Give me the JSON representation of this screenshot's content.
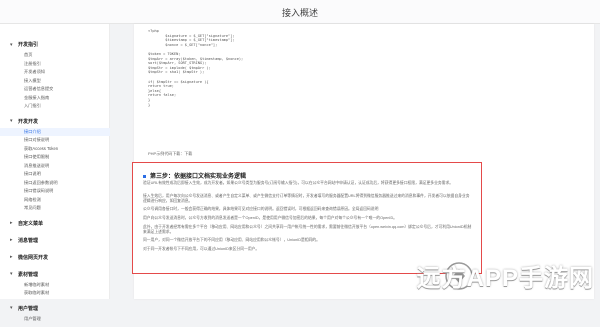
{
  "header": {
    "title": "接入概述"
  },
  "sidebar": {
    "sections": [
      {
        "label": "开发指引",
        "items": [
          "首页",
          "注册指引",
          "开发者须知",
          "接入模型",
          "运营者信息提交",
          "金服接入指南",
          "入门指引"
        ]
      },
      {
        "label": "开发开发",
        "items": [
          "接口介绍",
          "接口对接说明",
          "获取Access Token",
          "接口使用限制",
          "消息推送说明",
          "接口说明",
          "接口返回参数说明",
          "接口错误码说明",
          "网络检测",
          "常见问题"
        ],
        "active_index": 0
      },
      {
        "label": "自定义菜单",
        "items": []
      },
      {
        "label": "消息管理",
        "items": []
      },
      {
        "label": "微信网页开发",
        "items": []
      },
      {
        "label": "素材管理",
        "items": [
          "新增临时素材",
          "获取临时素材"
        ]
      },
      {
        "label": "用户管理",
        "items": [
          "用户管理"
        ]
      }
    ]
  },
  "code": {
    "lines": [
      "<?php",
      "        $signature = $_GET[\"signature\"];",
      "        $timestamp = $_GET[\"timestamp\"];",
      "        $nonce = $_GET[\"nonce\"];",
      "",
      "$token = TOKEN;",
      "$tmpArr = array($token, $timestamp, $nonce);",
      "sort($tmpArr, SORT_STRING);",
      "$tmpStr = implode( $tmpArr );",
      "$tmpStr = sha1( $tmpStr );",
      "",
      "if( $tmpStr == $signature ){",
      "return true;",
      "}else{",
      "return false;",
      "}",
      "}"
    ],
    "note": "PHP示例代码下载：下载"
  },
  "step": {
    "title": "第三步：依据接口文档实现业务逻辑",
    "paragraphs": [
      "验证URL有效性成功后即接入生效，成为开发者。如果公众号类型为服务号(订阅号输入指引)，可以在公众平台网站中申请认证，认证成功后，将获得更多接口权限，满足更多业务需求。",
      "接入生效后，用户每次向公众号发送消息、或者产生自定义菜单、或产生微信支付订单等情况时，开发者填写的服务器配置URL将得到微信服务器推送过来的消息和事件，开发者可以依据自身业务逻辑进行响应，如回复消息。",
      "公众号调用各接口时，一般会获得正确的结果，具体结果可见对应接口的说明。返回错误时，可根据返回码来查询错误原因。全局返回码说明",
      "用户向公众号发送消息时，公众号方收到的消息发送者是一个OpenID，是使用用户微信号加密后的结果，每个用户对每个公众号有一个唯一的OpenID。",
      "此外，由于开发者经常有需在多个平台（移动应用、网站应用和公众号）之间共享同一用户帐号统一性的需求，需要前往微信开放平台（open.weixin.qq.com）绑定公众号后，才可利用UnionID机制来满足上述需求。",
      "同一用户，对同一个微信开放平台下的不同应用（移动应用、网站应用和公众帐号），UnionID是相同的。",
      "对于同一开发者帐号下不同应用，可以通过UnionID来区分同一用户。"
    ],
    "link_text": "全局返回码说明"
  },
  "watermark": {
    "text": "远方APP手游网"
  }
}
